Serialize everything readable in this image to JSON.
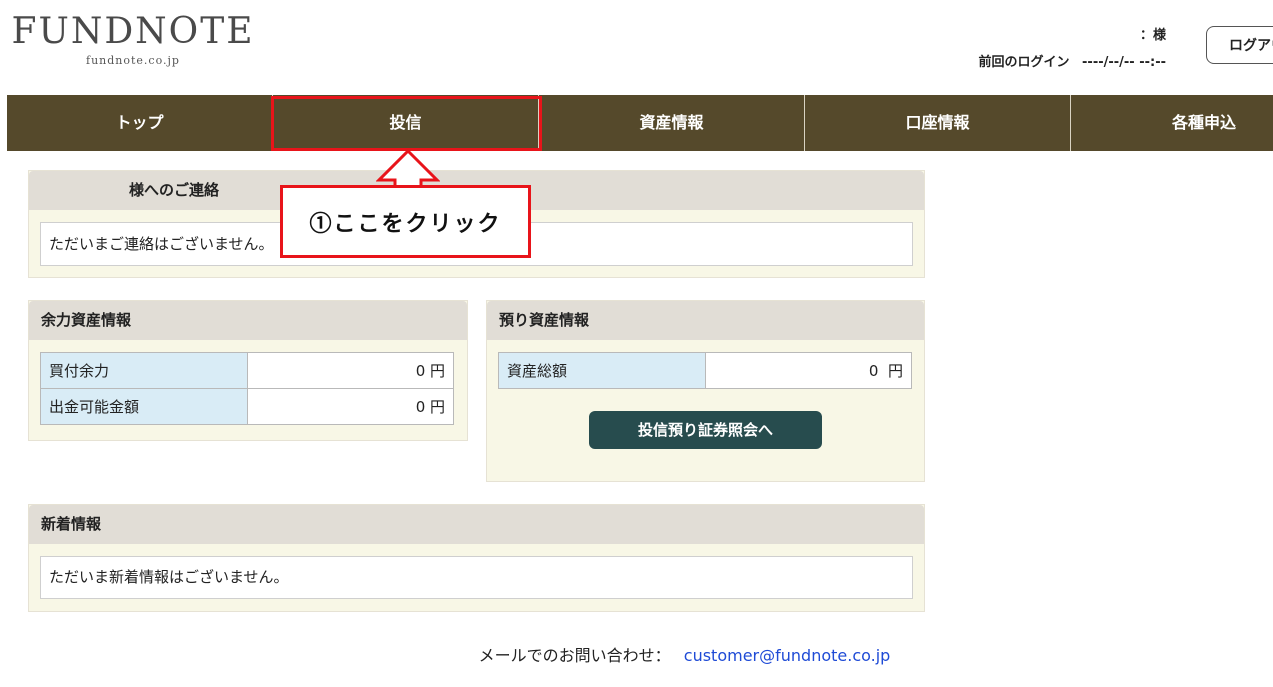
{
  "header": {
    "logo_main": "FUNDNOTE",
    "logo_sub": "fundnote.co.jp",
    "user_name": "：様",
    "last_login_label": "前回のログイン",
    "last_login_value": "----/--/-- --:--",
    "logout_label": "ログアウト"
  },
  "nav": {
    "tabs": [
      {
        "label": "トップ"
      },
      {
        "label": "投信"
      },
      {
        "label": "資産情報"
      },
      {
        "label": "口座情報"
      },
      {
        "label": "各種申込"
      }
    ]
  },
  "notice": {
    "title": "様へのご連絡",
    "message": "ただいまご連絡はございません。"
  },
  "spare_assets": {
    "title": "余力資産情報",
    "rows": [
      {
        "label": "買付余力",
        "value": "0 円"
      },
      {
        "label": "出金可能金額",
        "value": "0 円"
      }
    ]
  },
  "deposit_assets": {
    "title": "預り資産情報",
    "rows": [
      {
        "label": "資産総額",
        "value": "0  円"
      }
    ],
    "button_label": "投信預り証券照会へ"
  },
  "news": {
    "title": "新着情報",
    "message": "ただいま新着情報はございません。"
  },
  "footer": {
    "contact_label": "メールでのお問い合わせ：",
    "contact_email": "customer@fundnote.co.jp"
  },
  "annotation": {
    "callout_text": "①ここをクリック",
    "color": "#e8141a"
  }
}
